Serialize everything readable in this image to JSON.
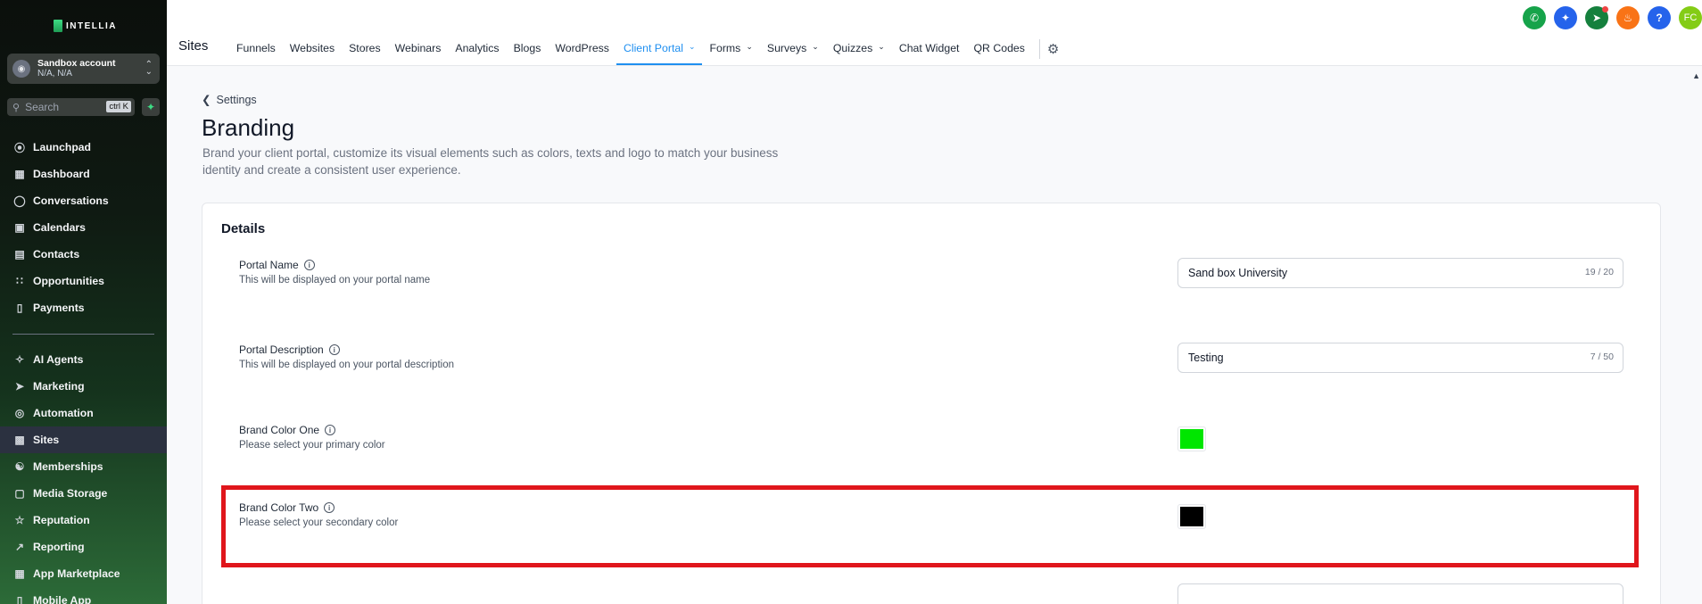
{
  "brand": {
    "logo_text": "INTELLIA"
  },
  "account": {
    "name": "Sandbox account",
    "location": "N/A, N/A"
  },
  "search": {
    "placeholder": "Search",
    "shortcut": "ctrl K"
  },
  "sidebar": {
    "items": [
      {
        "label": "Launchpad",
        "icon": "rocket-icon"
      },
      {
        "label": "Dashboard",
        "icon": "grid-icon"
      },
      {
        "label": "Conversations",
        "icon": "chat-icon"
      },
      {
        "label": "Calendars",
        "icon": "calendar-icon"
      },
      {
        "label": "Contacts",
        "icon": "contact-card-icon"
      },
      {
        "label": "Opportunities",
        "icon": "funnel-icon"
      },
      {
        "label": "Payments",
        "icon": "receipt-icon"
      },
      {
        "label": "AI Agents",
        "icon": "sparkle-icon"
      },
      {
        "label": "Marketing",
        "icon": "send-icon"
      },
      {
        "label": "Automation",
        "icon": "automation-icon"
      },
      {
        "label": "Sites",
        "icon": "globe-icon",
        "active": true
      },
      {
        "label": "Memberships",
        "icon": "membership-icon"
      },
      {
        "label": "Media Storage",
        "icon": "image-icon"
      },
      {
        "label": "Reputation",
        "icon": "star-icon"
      },
      {
        "label": "Reporting",
        "icon": "trend-icon"
      },
      {
        "label": "App Marketplace",
        "icon": "apps-icon"
      },
      {
        "label": "Mobile App",
        "icon": "phone-icon"
      }
    ]
  },
  "topbar": {
    "section_title": "Sites",
    "tabs": [
      {
        "label": "Funnels"
      },
      {
        "label": "Websites"
      },
      {
        "label": "Stores"
      },
      {
        "label": "Webinars"
      },
      {
        "label": "Analytics"
      },
      {
        "label": "Blogs"
      },
      {
        "label": "WordPress"
      },
      {
        "label": "Client Portal",
        "active": true,
        "dropdown": true
      },
      {
        "label": "Forms",
        "dropdown": true
      },
      {
        "label": "Surveys",
        "dropdown": true
      },
      {
        "label": "Quizzes",
        "dropdown": true
      },
      {
        "label": "Chat Widget"
      },
      {
        "label": "QR Codes"
      }
    ],
    "user_initials": "FC",
    "help_label": "?",
    "icon_colors": {
      "phone": "#16a34a",
      "magic": "#2563eb",
      "announce": "#15803d",
      "notifications": "#f97316",
      "help": "#2563eb",
      "avatar": "#84cc16"
    }
  },
  "page": {
    "back_label": "Settings",
    "title": "Branding",
    "description": "Brand your client portal, customize its visual elements such as colors, texts and logo to match your business identity and create a consistent user experience."
  },
  "details": {
    "title": "Details",
    "portal_name": {
      "label": "Portal Name",
      "help": "This will be displayed on your portal name",
      "value": "Sand box University",
      "counter": "19 / 20"
    },
    "portal_description": {
      "label": "Portal Description",
      "help": "This will be displayed on your portal description",
      "value": "Testing",
      "counter": "7 / 50"
    },
    "brand_color_one": {
      "label": "Brand Color One",
      "help": "Please select your primary color",
      "color": "#00e600"
    },
    "brand_color_two": {
      "label": "Brand Color Two",
      "help": "Please select your secondary color",
      "color": "#000000"
    }
  }
}
